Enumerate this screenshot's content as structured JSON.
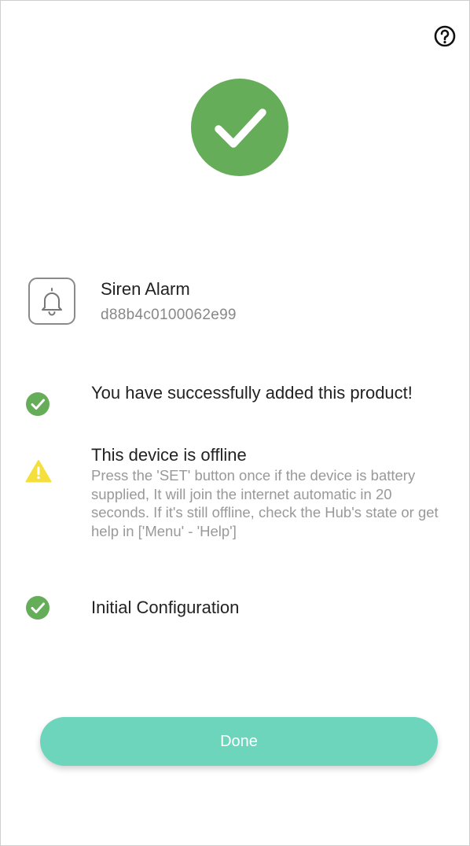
{
  "header": {
    "help_icon": "help-circle-icon"
  },
  "hero": {
    "icon": "check-icon",
    "color": "#66ad5a"
  },
  "device": {
    "icon": "bell-icon",
    "name": "Siren Alarm",
    "id": "d88b4c0100062e99"
  },
  "statuses": [
    {
      "icon": "check-circle-icon",
      "color": "#66ad5a",
      "title": "You have successfully added this product!"
    },
    {
      "icon": "warning-icon",
      "color": "#f5df3c",
      "title": "This device is offline",
      "description": "Press the 'SET' button once if the device is battery supplied, It will join the internet automatic in 20 seconds. If it's still offline, check the Hub's state or get help in ['Menu' - 'Help']"
    },
    {
      "icon": "check-circle-icon",
      "color": "#66ad5a",
      "title": "Initial Configuration"
    }
  ],
  "footer": {
    "done_label": "Done",
    "done_color": "#6cd5bb"
  }
}
